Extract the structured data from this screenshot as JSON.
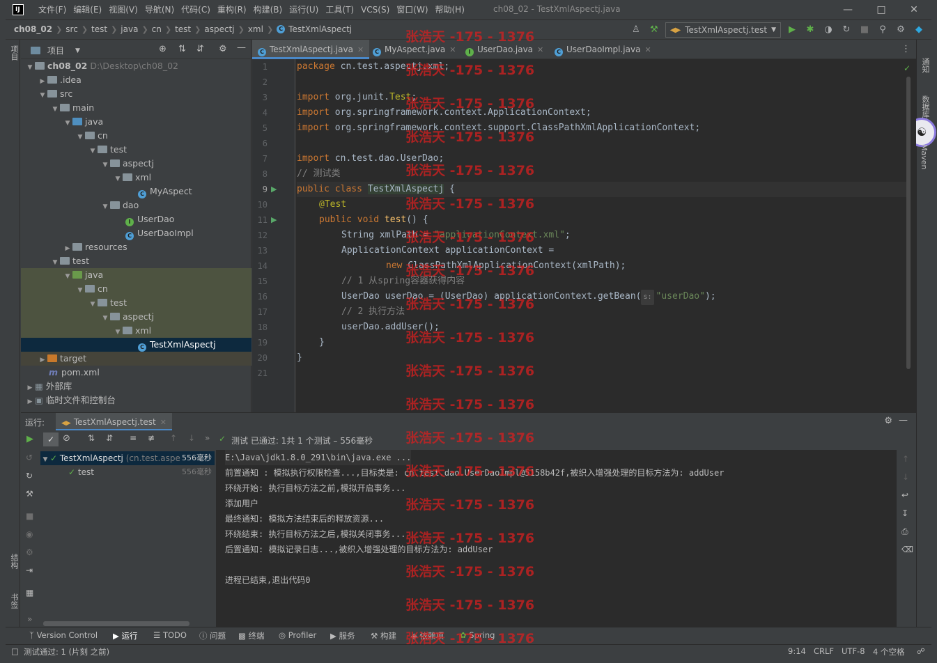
{
  "window": {
    "title": "ch08_02 - TestXmlAspectj.java",
    "logo": "IJ",
    "menu": [
      "文件(F)",
      "编辑(E)",
      "视图(V)",
      "导航(N)",
      "代码(C)",
      "重构(R)",
      "构建(B)",
      "运行(U)",
      "工具(T)",
      "VCS(S)",
      "窗口(W)",
      "帮助(H)"
    ]
  },
  "breadcrumb": [
    "ch08_02",
    "src",
    "test",
    "java",
    "cn",
    "test",
    "aspectj",
    "xml",
    "TestXmlAspectj"
  ],
  "run_config": "TestXmlAspectj.test",
  "left_stripe": [
    "项目",
    "结构",
    "书签"
  ],
  "right_stripe": [
    "通知",
    "数据库",
    "Maven"
  ],
  "project": {
    "title": "项目",
    "tree": [
      {
        "label": "ch08_02",
        "suffix": "D:\\Desktop\\ch08_02"
      },
      {
        "label": ".idea"
      },
      {
        "label": "src"
      },
      {
        "label": "main"
      },
      {
        "label": "java"
      },
      {
        "label": "cn"
      },
      {
        "label": "test"
      },
      {
        "label": "aspectj"
      },
      {
        "label": "xml"
      },
      {
        "label": "MyAspect"
      },
      {
        "label": "dao"
      },
      {
        "label": "UserDao"
      },
      {
        "label": "UserDaoImpl"
      },
      {
        "label": "resources"
      },
      {
        "label": "test"
      },
      {
        "label": "java"
      },
      {
        "label": "cn"
      },
      {
        "label": "test"
      },
      {
        "label": "aspectj"
      },
      {
        "label": "xml"
      },
      {
        "label": "TestXmlAspectj"
      },
      {
        "label": "target"
      },
      {
        "label": "pom.xml"
      },
      {
        "label": "外部库"
      },
      {
        "label": "临时文件和控制台"
      }
    ]
  },
  "editor_tabs": [
    "TestXmlAspectj.java",
    "MyAspect.java",
    "UserDao.java",
    "UserDaoImpl.java"
  ],
  "code": {
    "line_numbers": [
      "1",
      "2",
      "3",
      "4",
      "5",
      "6",
      "7",
      "8",
      "9",
      "10",
      "11",
      "12",
      "13",
      "14",
      "15",
      "16",
      "17",
      "18",
      "19",
      "20",
      "21"
    ],
    "l1a": "package",
    "l1b": " cn.test.aspectj.xml;",
    "l3a": "import",
    "l3b": " org.junit.",
    "l3c": "Test",
    "l3d": ";",
    "l4a": "import",
    "l4b": " org.springframework.context.ApplicationContext;",
    "l5a": "import",
    "l5b": " org.springframework.context.support.ClassPathXmlApplicationContext;",
    "l7a": "import",
    "l7b": " cn.test.dao.UserDao;",
    "l8": "// 测试类",
    "l9a": "public class",
    "l9b": "TestXmlAspectj",
    "l9c": " {",
    "l10": "@Test",
    "l11a": "public void",
    "l11b": "test",
    "l11c": "() {",
    "l12a": "String xmlPath = ",
    "l12b": "\"applicationContext.xml\"",
    "l12c": ";",
    "l13": "ApplicationContext applicationContext =",
    "l14a": "new",
    "l14b": " ClassPathXmlApplicationContext(xmlPath);",
    "l15": "// 1 从spring容器获得内容",
    "l16a": "UserDao userDao = (UserDao) applicationContext.getBean(",
    "l16hint": "s:",
    "l16b": "\"userDao\"",
    "l16c": ");",
    "l17": "// 2 执行方法",
    "l18": "userDao.addUser();",
    "l19": "}",
    "l20": "}"
  },
  "run": {
    "label": "运行:",
    "tab": "TestXmlAspectj.test",
    "status": "测试 已通过: 1共 1 个测试 – 556毫秒",
    "tree": [
      {
        "name": "TestXmlAspectj",
        "detail": "(cn.test.aspe",
        "time": "556毫秒"
      },
      {
        "name": "test",
        "time": "556毫秒"
      }
    ],
    "console": [
      "E:\\Java\\jdk1.8.0_291\\bin\\java.exe ...",
      "前置通知 : 模拟执行权限检查...,目标类是: cn.test.dao.UserDaoImpl@5158b42f,被织入增强处理的目标方法为: addUser",
      "环绕开始: 执行目标方法之前,模拟开启事务...",
      "添加用户",
      "最终通知: 模拟方法结束后的释放资源...",
      "环绕结束: 执行目标方法之后,模拟关闭事务...",
      "后置通知: 模拟记录日志...,被织入增强处理的目标方法为: addUser",
      "",
      "进程已结束,退出代码0"
    ]
  },
  "tool_tabs": [
    "Version Control",
    "运行",
    "TODO",
    "问题",
    "终端",
    "Profiler",
    "服务",
    "构建",
    "依赖项",
    "Spring"
  ],
  "status_bar": {
    "message": "测试通过: 1 (片刻 之前)",
    "position": "9:14",
    "line_sep": "CRLF",
    "encoding": "UTF-8",
    "indent": "4 个空格"
  },
  "watermark": "张浩天 -175 - 1376",
  "colors": {
    "accent": "#4a88c7",
    "pass": "#5fb04a",
    "watermark": "#dc1e1e"
  }
}
